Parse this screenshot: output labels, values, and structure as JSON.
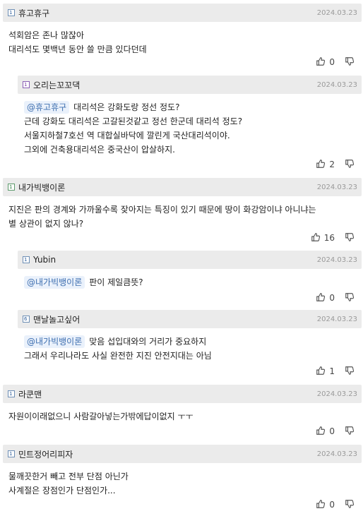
{
  "comments": [
    {
      "nick": "휴고휴구",
      "level": "1",
      "level_color": "blue",
      "date": "2024.03.23",
      "lines": [
        "석회암은 존나 많잖아",
        "대리석도 몇백년 동안 쓸 만큼 있다던데"
      ],
      "likes": "0",
      "reply": false
    },
    {
      "nick": "오리는꼬꼬댁",
      "level": "1",
      "level_color": "purple",
      "date": "2024.03.23",
      "mention": "@휴고휴구",
      "first_line": "대리석은 강화도랑 정선 정도?",
      "lines": [
        "근데 강화도 대리석은 고갈된것같고 정선 한군데 대리석 정도?",
        "서울지하철7호선 역 대합실바닥에 깔린게 국산대리석이야.",
        "그외에 건축용대리석은 중국산이 압살하지."
      ],
      "likes": "2",
      "reply": true
    },
    {
      "nick": "내가빅뱅이론",
      "level": "1",
      "level_color": "green",
      "date": "2024.03.23",
      "lines": [
        "지진은 판의 경계와 가까울수록 잦아지는 특징이 있기 때문에 땅이 화강암이냐 아니냐는",
        "별 상관이 없지 않나?"
      ],
      "likes": "16",
      "reply": false
    },
    {
      "nick": "Yubin",
      "level": "1",
      "level_color": "blue",
      "date": "2024.03.23",
      "mention": "@내가빅뱅이론",
      "first_line": "판이 제일큼뜻?",
      "lines": [],
      "likes": "0",
      "reply": true
    },
    {
      "nick": "맨날놀고싶어",
      "level": "6",
      "level_color": "blue",
      "date": "2024.03.23",
      "mention": "@내가빅뱅이론",
      "first_line": "맞음 섭입대와의 거리가 중요하지",
      "lines": [
        "그래서 우리나라도 사실 완전한 지진 안전지대는 아님"
      ],
      "likes": "1",
      "reply": true
    },
    {
      "nick": "라쿤맨",
      "level": "1",
      "level_color": "blue",
      "date": "2024.03.23",
      "lines": [
        "자원이이래없으니 사람갈아넣는가밖에답이없지 ㅜㅜ"
      ],
      "likes": "0",
      "reply": false
    },
    {
      "nick": "민트정어리피자",
      "level": "1",
      "level_color": "blue",
      "date": "2024.03.23",
      "lines": [
        "물깨끗한거 빼고 전부 단점 아닌가",
        "사계절은 장점인가 단점인가..."
      ],
      "likes": "0",
      "reply": false
    }
  ],
  "icons": {
    "level": "level-badge-icon",
    "like": "thumbs-up-icon",
    "dislike": "thumbs-down-icon"
  }
}
